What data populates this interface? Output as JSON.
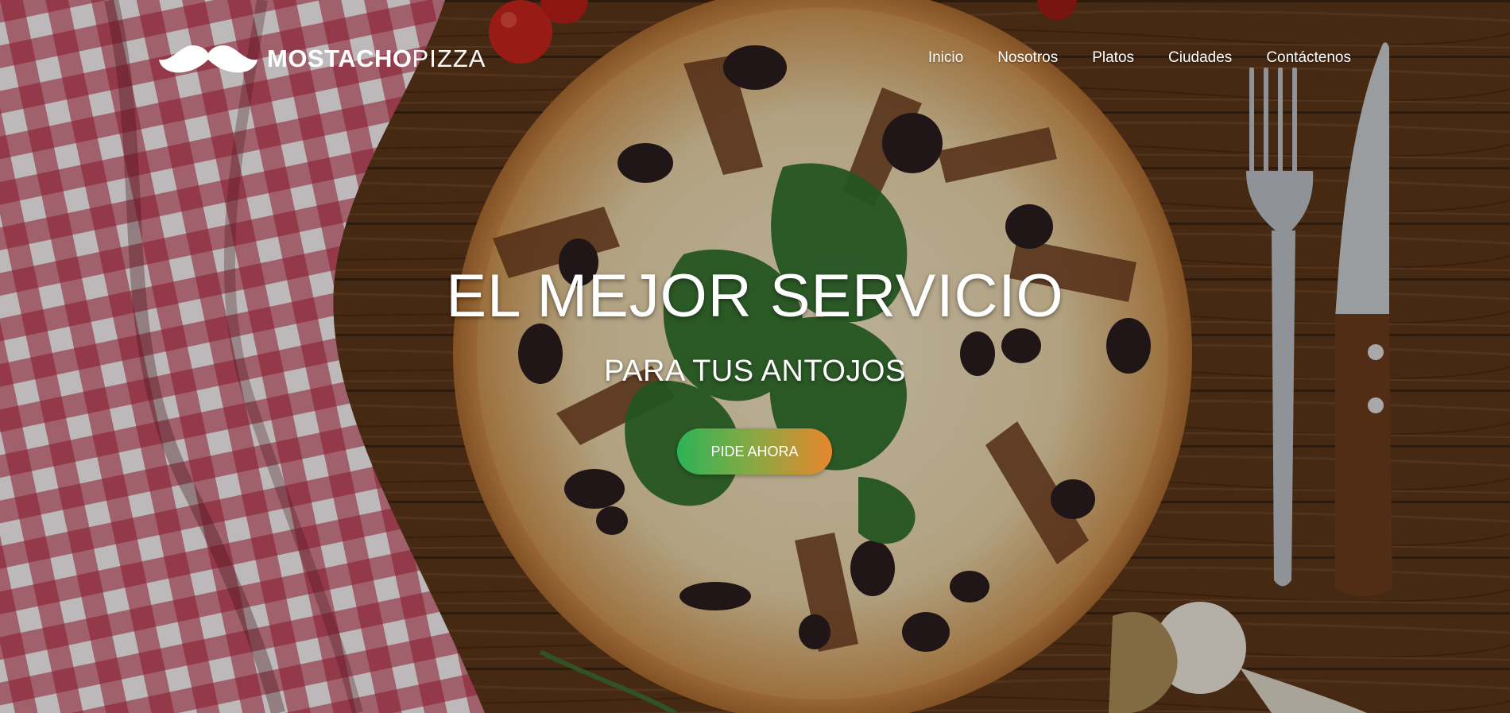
{
  "brand": {
    "logo_icon": "mustache-icon",
    "name_strong": "MOSTACHO",
    "name_light": "PIZZA"
  },
  "nav": {
    "items": [
      {
        "label": "Inicio"
      },
      {
        "label": "Nosotros"
      },
      {
        "label": "Platos"
      },
      {
        "label": "Ciudades"
      },
      {
        "label": "Contáctenos"
      }
    ]
  },
  "hero": {
    "title": "EL MEJOR SERVICIO",
    "subtitle": "PARA TUS ANTOJOS",
    "cta_label": "PIDE AHORA",
    "cta_gradient": [
      "#2db357",
      "#e8862c"
    ]
  },
  "colors": {
    "wood": "#5a3519",
    "tablecloth_red": "#b0203a",
    "text": "#ffffff"
  }
}
